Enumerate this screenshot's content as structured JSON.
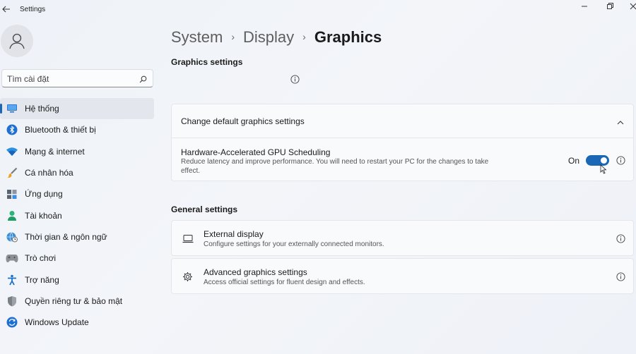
{
  "window": {
    "title": "Settings"
  },
  "sidebar": {
    "search_placeholder": "Tìm cài đặt",
    "items": [
      {
        "label": "Hệ thống",
        "icon": "monitor-icon",
        "active": true
      },
      {
        "label": "Bluetooth & thiết bị",
        "icon": "bluetooth-icon"
      },
      {
        "label": "Mạng & internet",
        "icon": "wifi-icon"
      },
      {
        "label": "Cá nhân hóa",
        "icon": "brush-icon"
      },
      {
        "label": "Ứng dụng",
        "icon": "apps-icon"
      },
      {
        "label": "Tài khoản",
        "icon": "person-icon"
      },
      {
        "label": "Thời gian & ngôn ngữ",
        "icon": "globe-clock-icon"
      },
      {
        "label": "Trò chơi",
        "icon": "gamepad-icon"
      },
      {
        "label": "Trợ năng",
        "icon": "accessibility-icon"
      },
      {
        "label": "Quyền riêng tư & bảo mật",
        "icon": "shield-icon"
      },
      {
        "label": "Windows Update",
        "icon": "update-icon"
      }
    ]
  },
  "breadcrumb": {
    "items": [
      "System",
      "Display",
      "Graphics"
    ]
  },
  "graphics_settings": {
    "title": "Graphics settings"
  },
  "default_card": {
    "title": "Change default graphics settings"
  },
  "gpu_scheduling": {
    "title": "Hardware-Accelerated GPU Scheduling",
    "description_line1": "Reduce latency and improve performance. You will need to restart your PC for the changes to take",
    "description_line2": "effect.",
    "state_label": "On",
    "enabled": true
  },
  "general_settings": {
    "title": "General settings"
  },
  "external_display": {
    "title": "External display",
    "description": "Configure settings for your externally connected monitors."
  },
  "advanced_graphics": {
    "title": "Advanced graphics settings",
    "description": "Access official settings for fluent design and effects."
  },
  "colors": {
    "accent": "#1a67b5"
  }
}
